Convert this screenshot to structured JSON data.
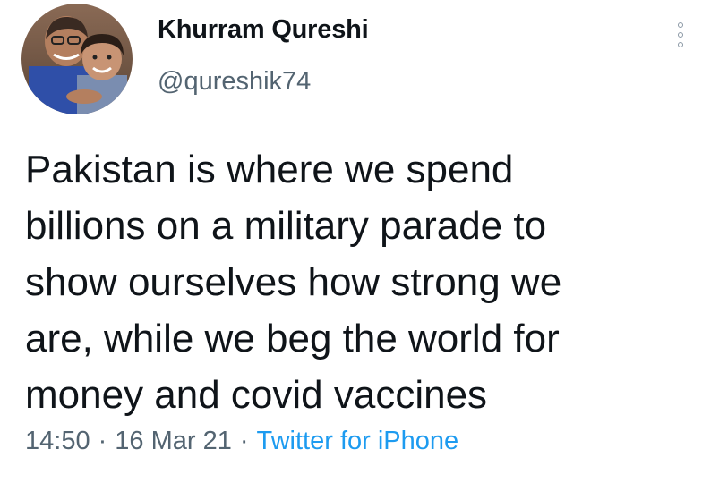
{
  "author": {
    "display_name": "Khurram Qureshi",
    "handle": "@qureshik74"
  },
  "tweet": {
    "lines": [
      "Pakistan is where we spend",
      "billions on a military parade to",
      "show ourselves how strong we",
      "are, while we beg the world for",
      "money and covid vaccines"
    ],
    "time": "14:50",
    "separator": "·",
    "date": "16 Mar 21",
    "source": "Twitter for iPhone"
  },
  "menu": {
    "icon": "more-vertical-icon"
  },
  "colors": {
    "text": "#0f1419",
    "secondary": "#536471",
    "link": "#1d9bf0"
  }
}
